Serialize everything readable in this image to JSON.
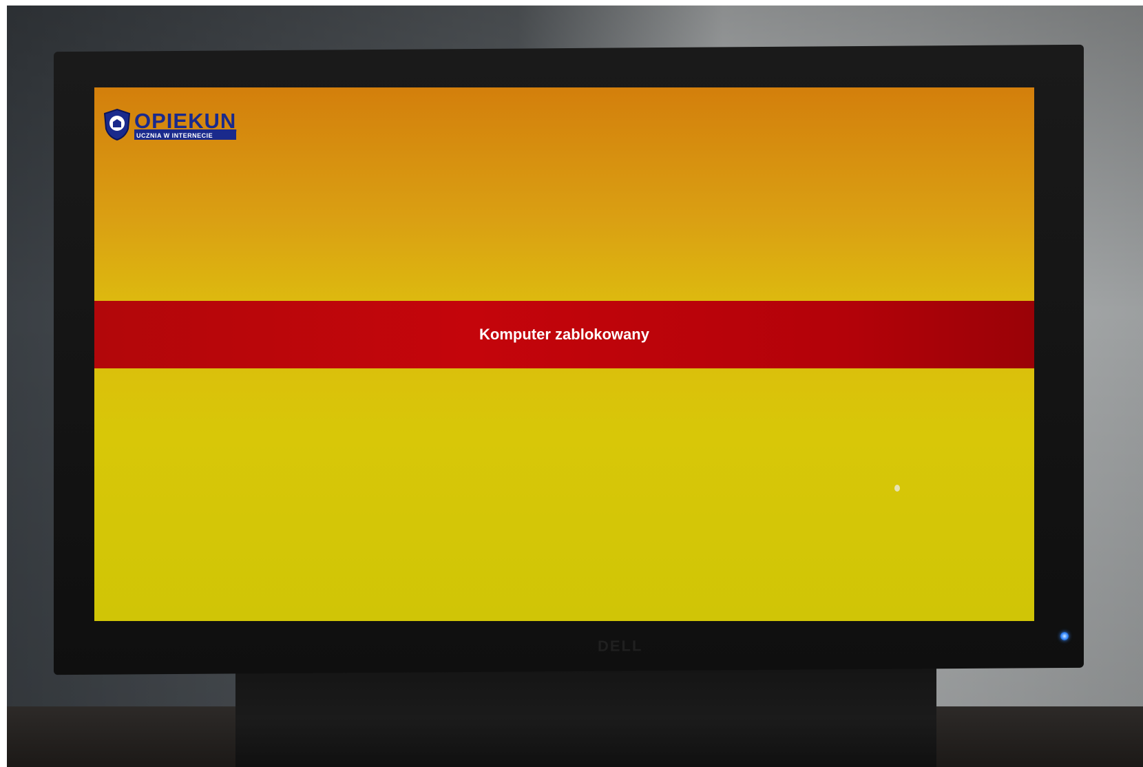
{
  "app": {
    "logo": {
      "title": "OPIEKUN",
      "subtitle": "UCZNIA W INTERNECIE",
      "icon": "shield-logo-icon"
    },
    "banner": {
      "message": "Komputer zablokowany"
    }
  },
  "colors": {
    "background_top": "#d37f0c",
    "background_bottom": "#d8c708",
    "banner": "#c4050b",
    "logo": "#1a2a8c"
  }
}
